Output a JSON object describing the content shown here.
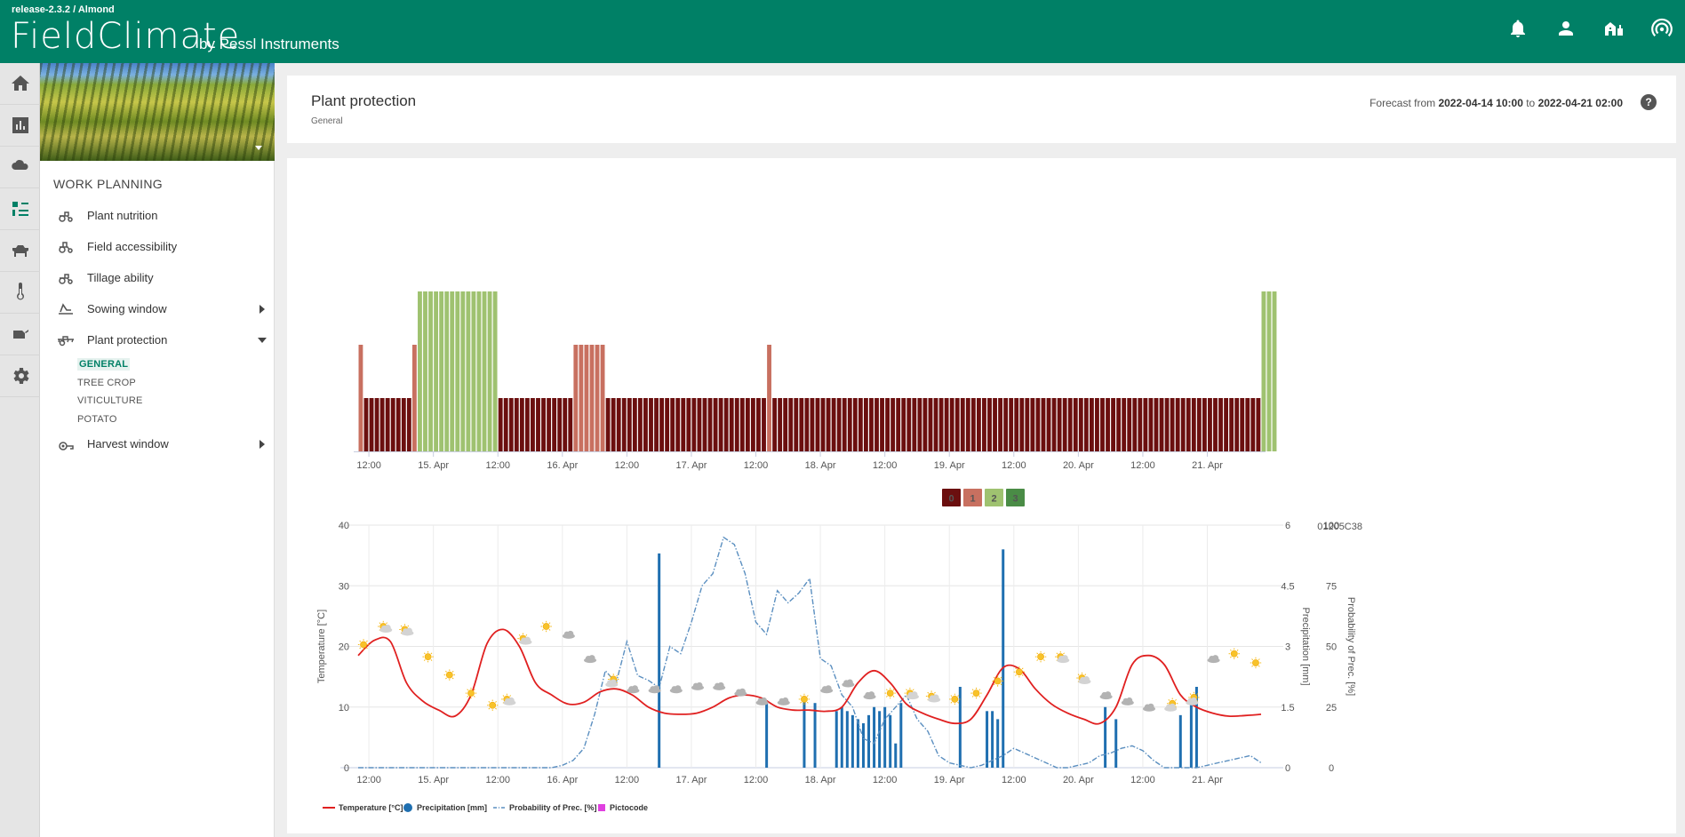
{
  "app": {
    "release": "release-2.3.2 / Almond",
    "logo_text": "FieldClimate",
    "byline": "by Pessl Instruments"
  },
  "topbar_icons": [
    "bell-icon",
    "user-icon",
    "farm-icon",
    "station-signal-icon"
  ],
  "rail_icons": [
    "home-icon",
    "chart-icon",
    "weather-icon",
    "work-planning-icon",
    "animal-icon",
    "thermometer-icon",
    "sprayer-icon",
    "settings-icon"
  ],
  "sidebar": {
    "section_title": "WORK PLANNING",
    "items": [
      {
        "label": "Plant nutrition",
        "icon": "tractor-icon"
      },
      {
        "label": "Field accessibility",
        "icon": "tractor-icon"
      },
      {
        "label": "Tillage ability",
        "icon": "tractor-icon"
      },
      {
        "label": "Sowing window",
        "icon": "sowing-icon"
      },
      {
        "label": "Plant protection",
        "icon": "sprayer-icon"
      },
      {
        "label": "Harvest window",
        "icon": "harvester-icon"
      }
    ],
    "sub_items": [
      "GENERAL",
      "TREE CROP",
      "VITICULTURE",
      "POTATO"
    ]
  },
  "header": {
    "title": "Plant protection",
    "subtitle": "General",
    "forecast_from_label": "Forecast from",
    "forecast_from": "2022-04-14 10:00",
    "forecast_to_label": "to",
    "forecast_to": "2022-04-21 02:00",
    "help": "?"
  },
  "colors": {
    "class0": "#6b0f0f",
    "class1": "#c87060",
    "class2": "#9fc270",
    "class3": "#4a8c46",
    "temperature": "#e02020",
    "precipitation": "#1f6fb0",
    "probability": "#5b8fc0",
    "pictocode": "#e040e0",
    "brand": "#008066"
  },
  "chart_data": [
    {
      "type": "bar",
      "x_tick_labels": [
        "12:00",
        "15. Apr",
        "12:00",
        "16. Apr",
        "12:00",
        "17. Apr",
        "12:00",
        "18. Apr",
        "12:00",
        "19. Apr",
        "12:00",
        "20. Apr",
        "12:00",
        "21. Apr"
      ],
      "legend": [
        "0",
        "1",
        "2",
        "3"
      ],
      "segments": [
        {
          "hours": 1,
          "class": 1
        },
        {
          "hours": 9,
          "class": 0
        },
        {
          "hours": 1,
          "class": 1
        },
        {
          "hours": 15,
          "class": 2
        },
        {
          "hours": 14,
          "class": 0
        },
        {
          "hours": 6,
          "class": 1
        },
        {
          "hours": 30,
          "class": 0
        },
        {
          "hours": 1,
          "class": 1
        },
        {
          "hours": 91,
          "class": 0
        },
        {
          "hours": 3,
          "class": 2
        }
      ]
    },
    {
      "type": "line",
      "station_id": "01205C38",
      "x_tick_labels": [
        "12:00",
        "15. Apr",
        "12:00",
        "16. Apr",
        "12:00",
        "17. Apr",
        "12:00",
        "18. Apr",
        "12:00",
        "19. Apr",
        "12:00",
        "20. Apr",
        "12:00",
        "21. Apr"
      ],
      "y_left": {
        "label": "Temperature [°C]",
        "ticks": [
          "0",
          "10",
          "20",
          "30",
          "40"
        ],
        "lim": [
          0,
          40
        ]
      },
      "y_right1": {
        "label": "Precipitation [mm]",
        "ticks": [
          "0",
          "1.5",
          "3",
          "4.5",
          "6"
        ],
        "lim": [
          0,
          6
        ]
      },
      "y_right2": {
        "label": "Probability of Prec. [%]",
        "ticks": [
          "0",
          "25",
          "50",
          "75",
          "100"
        ],
        "lim": [
          0,
          100
        ]
      },
      "legend": [
        "Temperature [°C]",
        "Precipitation [mm]",
        "Probability of Prec. [%]",
        "Pictocode"
      ],
      "temperature": {
        "hours": [
          0,
          3,
          6,
          9,
          12,
          15,
          18,
          21,
          24,
          27,
          30,
          33,
          36,
          39,
          42,
          45,
          48,
          51,
          54,
          57,
          60,
          63,
          66,
          69,
          72,
          75,
          78,
          81,
          84,
          87,
          90,
          93,
          96,
          99,
          102,
          105,
          108,
          111,
          114,
          117,
          120,
          123,
          126,
          129,
          132,
          135,
          138,
          141,
          144,
          147,
          150,
          153,
          156,
          159,
          162,
          165,
          168
        ],
        "values": [
          18.5,
          21,
          20.8,
          14,
          11,
          9.5,
          8.5,
          12,
          20.5,
          22.8,
          20,
          14,
          12,
          10.5,
          10.8,
          12.5,
          13,
          12,
          10,
          9,
          8.8,
          9,
          10,
          11.5,
          12,
          11.5,
          10,
          9.5,
          9.5,
          9.3,
          10,
          14,
          16,
          14,
          10.5,
          9,
          8,
          7.3,
          8,
          12,
          16.5,
          16.3,
          13,
          10.5,
          9,
          8,
          7.3,
          10,
          17,
          18.5,
          17,
          12,
          10,
          9,
          8.5,
          8.6,
          8.8
        ]
      },
      "precipitation": {
        "hours": [
          56,
          76,
          83,
          85,
          89,
          90,
          91,
          92,
          93,
          94,
          95,
          96,
          97,
          98,
          99,
          100,
          101,
          112,
          117,
          118,
          119,
          120,
          139,
          141,
          153,
          155,
          156
        ],
        "values": [
          5.3,
          1.6,
          1.7,
          1.6,
          1.4,
          1.5,
          1.4,
          1.3,
          1.2,
          1.1,
          1.3,
          1.5,
          1.4,
          1.5,
          1.3,
          0.6,
          1.6,
          2.0,
          1.4,
          1.4,
          1.2,
          5.4,
          1.5,
          1.2,
          1.3,
          1.7,
          2.0
        ]
      },
      "probability": {
        "hours": [
          0,
          4,
          8,
          12,
          16,
          20,
          24,
          28,
          32,
          36,
          38,
          40,
          42,
          44,
          46,
          48,
          50,
          52,
          54,
          56,
          58,
          60,
          62,
          64,
          66,
          68,
          70,
          72,
          74,
          76,
          78,
          80,
          82,
          84,
          86,
          88,
          90,
          92,
          94,
          96,
          98,
          100,
          102,
          104,
          106,
          108,
          110,
          112,
          114,
          116,
          118,
          120,
          122,
          124,
          126,
          128,
          130,
          132,
          134,
          136,
          138,
          140,
          142,
          144,
          146,
          148,
          150,
          152,
          154,
          156,
          158,
          160,
          162,
          164,
          166,
          168
        ],
        "values": [
          0,
          0,
          0,
          0,
          0,
          0,
          0,
          0,
          0,
          0,
          1,
          3,
          8,
          22,
          40,
          35,
          52,
          38,
          36,
          33,
          50,
          47,
          60,
          75,
          80,
          95,
          92,
          80,
          60,
          55,
          73,
          68,
          72,
          78,
          45,
          42,
          30,
          25,
          12,
          10,
          20,
          25,
          30,
          20,
          15,
          5,
          2,
          1,
          0,
          1,
          3,
          5,
          8,
          6,
          4,
          2,
          0,
          0,
          1,
          2,
          5,
          6,
          8,
          9,
          7,
          3,
          0,
          0,
          0,
          0,
          1,
          2,
          3,
          4,
          5,
          2
        ]
      },
      "pictocodes": {
        "hours": [
          1,
          5,
          9,
          13,
          17,
          21,
          25,
          28,
          31,
          35,
          39,
          43,
          47,
          51,
          55,
          59,
          63,
          67,
          71,
          75,
          79,
          83,
          87,
          91,
          95,
          99,
          103,
          107,
          111,
          115,
          119,
          123,
          127,
          131,
          135,
          139,
          143,
          147,
          151,
          155,
          159,
          163,
          167
        ],
        "kinds": [
          "sun",
          "sun-cloud",
          "sun-cloud",
          "sun",
          "sun",
          "sun",
          "sun",
          "sun-cloud",
          "sun-cloud",
          "sun",
          "cloud",
          "cloud",
          "cloud-sun",
          "cloud",
          "cloud",
          "cloud",
          "cloud",
          "cloud",
          "cloud",
          "cloud",
          "cloud",
          "sun",
          "cloud",
          "cloud",
          "cloud",
          "sun",
          "sun-cloud",
          "sun-cloud",
          "sun",
          "sun",
          "sun",
          "sun",
          "sun",
          "sun-cloud",
          "sun-cloud",
          "cloud",
          "cloud",
          "cloud",
          "cloud-sun",
          "cloud-sun",
          "cloud",
          "sun",
          "sun"
        ],
        "temps": [
          20,
          23,
          22.5,
          18,
          15,
          12,
          10,
          11,
          21,
          23,
          22,
          18,
          14,
          13,
          13,
          13,
          13.5,
          13.5,
          12.5,
          11,
          11,
          11,
          13,
          14,
          12,
          12,
          12,
          11.5,
          11,
          12,
          14,
          15.5,
          18,
          18,
          14.5,
          12,
          11,
          10,
          10,
          11,
          18,
          18.5,
          17
        ]
      }
    }
  ]
}
